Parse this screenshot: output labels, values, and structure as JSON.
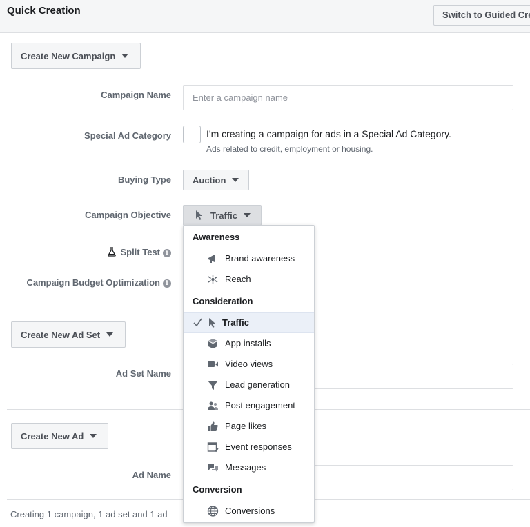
{
  "header": {
    "title": "Quick Creation",
    "switch_label": "Switch to Guided Creation"
  },
  "campaign": {
    "dropdown_label": "Create New Campaign",
    "name_label": "Campaign Name",
    "name_placeholder": "Enter a campaign name",
    "special_ad_label": "Special Ad Category",
    "special_ad_text": "I'm creating a campaign for ads in a Special Ad Category.",
    "special_ad_sub": "Ads related to credit, employment or housing.",
    "buying_type_label": "Buying Type",
    "buying_type_value": "Auction",
    "objective_label": "Campaign Objective",
    "objective_value": "Traffic",
    "split_test_label": "Split Test",
    "cbo_label": "Campaign Budget Optimization"
  },
  "adset": {
    "dropdown_label": "Create New Ad Set",
    "name_label": "Ad Set Name"
  },
  "ad": {
    "dropdown_label": "Create New Ad",
    "name_label": "Ad Name"
  },
  "footer": {
    "text": "Creating 1 campaign, 1 ad set and 1 ad"
  },
  "objective_menu": {
    "groups": [
      {
        "heading": "Awareness",
        "items": [
          {
            "label": "Brand awareness",
            "icon": "megaphone-icon"
          },
          {
            "label": "Reach",
            "icon": "reach-icon"
          }
        ]
      },
      {
        "heading": "Consideration",
        "items": [
          {
            "label": "Traffic",
            "icon": "cursor-icon",
            "selected": true
          },
          {
            "label": "App installs",
            "icon": "box-icon"
          },
          {
            "label": "Video views",
            "icon": "video-camera-icon"
          },
          {
            "label": "Lead generation",
            "icon": "funnel-icon"
          },
          {
            "label": "Post engagement",
            "icon": "people-icon"
          },
          {
            "label": "Page likes",
            "icon": "thumbs-up-icon"
          },
          {
            "label": "Event responses",
            "icon": "calendar-icon"
          },
          {
            "label": "Messages",
            "icon": "chat-bubbles-icon"
          }
        ]
      },
      {
        "heading": "Conversion",
        "items": [
          {
            "label": "Conversions",
            "icon": "globe-icon"
          }
        ]
      }
    ]
  },
  "colors": {
    "accent_blue": "#4267b2",
    "selected_bg": "#ebf0f8",
    "label_gray": "#606770",
    "border": "#ccd0d5"
  }
}
